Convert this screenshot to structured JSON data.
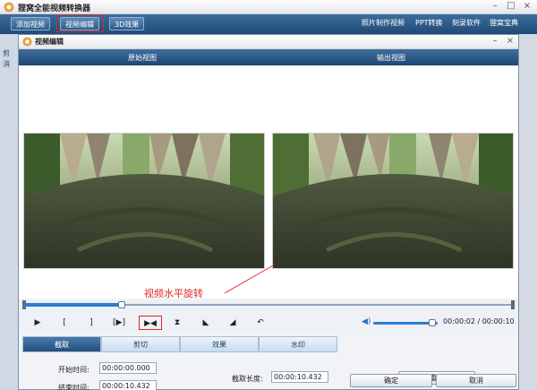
{
  "app": {
    "title": "狸窝全能视频转换器",
    "toolbar": {
      "add_video": "添加视频",
      "video_edit": "视频编辑",
      "effect_3d": "3D效果"
    },
    "links": [
      "照片制作视频",
      "PPT转换",
      "刻录软件",
      "狸窝宝典"
    ],
    "side_text": [
      "剪",
      "消"
    ]
  },
  "dialog": {
    "title": "视频编辑",
    "original_view": "原始视图",
    "output_view": "输出视图",
    "annotation": "视频水平旋转",
    "time_display": "00:00:02 / 00:00:10",
    "tabs": [
      "截取",
      "剪切",
      "效果",
      "水印"
    ],
    "start_label": "开始时间:",
    "start_value": "00:00:00.000",
    "end_label": "结束时间:",
    "end_value": "00:00:10.432",
    "length_label": "截取长度:",
    "length_value": "00:00:10.432",
    "reset": "重置",
    "ok": "确定",
    "cancel": "取消"
  },
  "progress": {
    "playback_fraction": 0.2,
    "volume_fraction": 0.92
  },
  "colors": {
    "toolbar": "#1f4a77",
    "accent_blue": "#2c7bd1",
    "annotation_red": "#e02a2a"
  },
  "icons": [
    "app-logo-icon",
    "minimize-icon",
    "maximize-icon",
    "close-icon",
    "play-icon",
    "mark-in-icon",
    "mark-out-icon",
    "next-frame-icon",
    "flip-horizontal-icon",
    "flip-vertical-icon",
    "rotate-left-icon",
    "rotate-right-icon",
    "undo-icon",
    "volume-icon"
  ]
}
